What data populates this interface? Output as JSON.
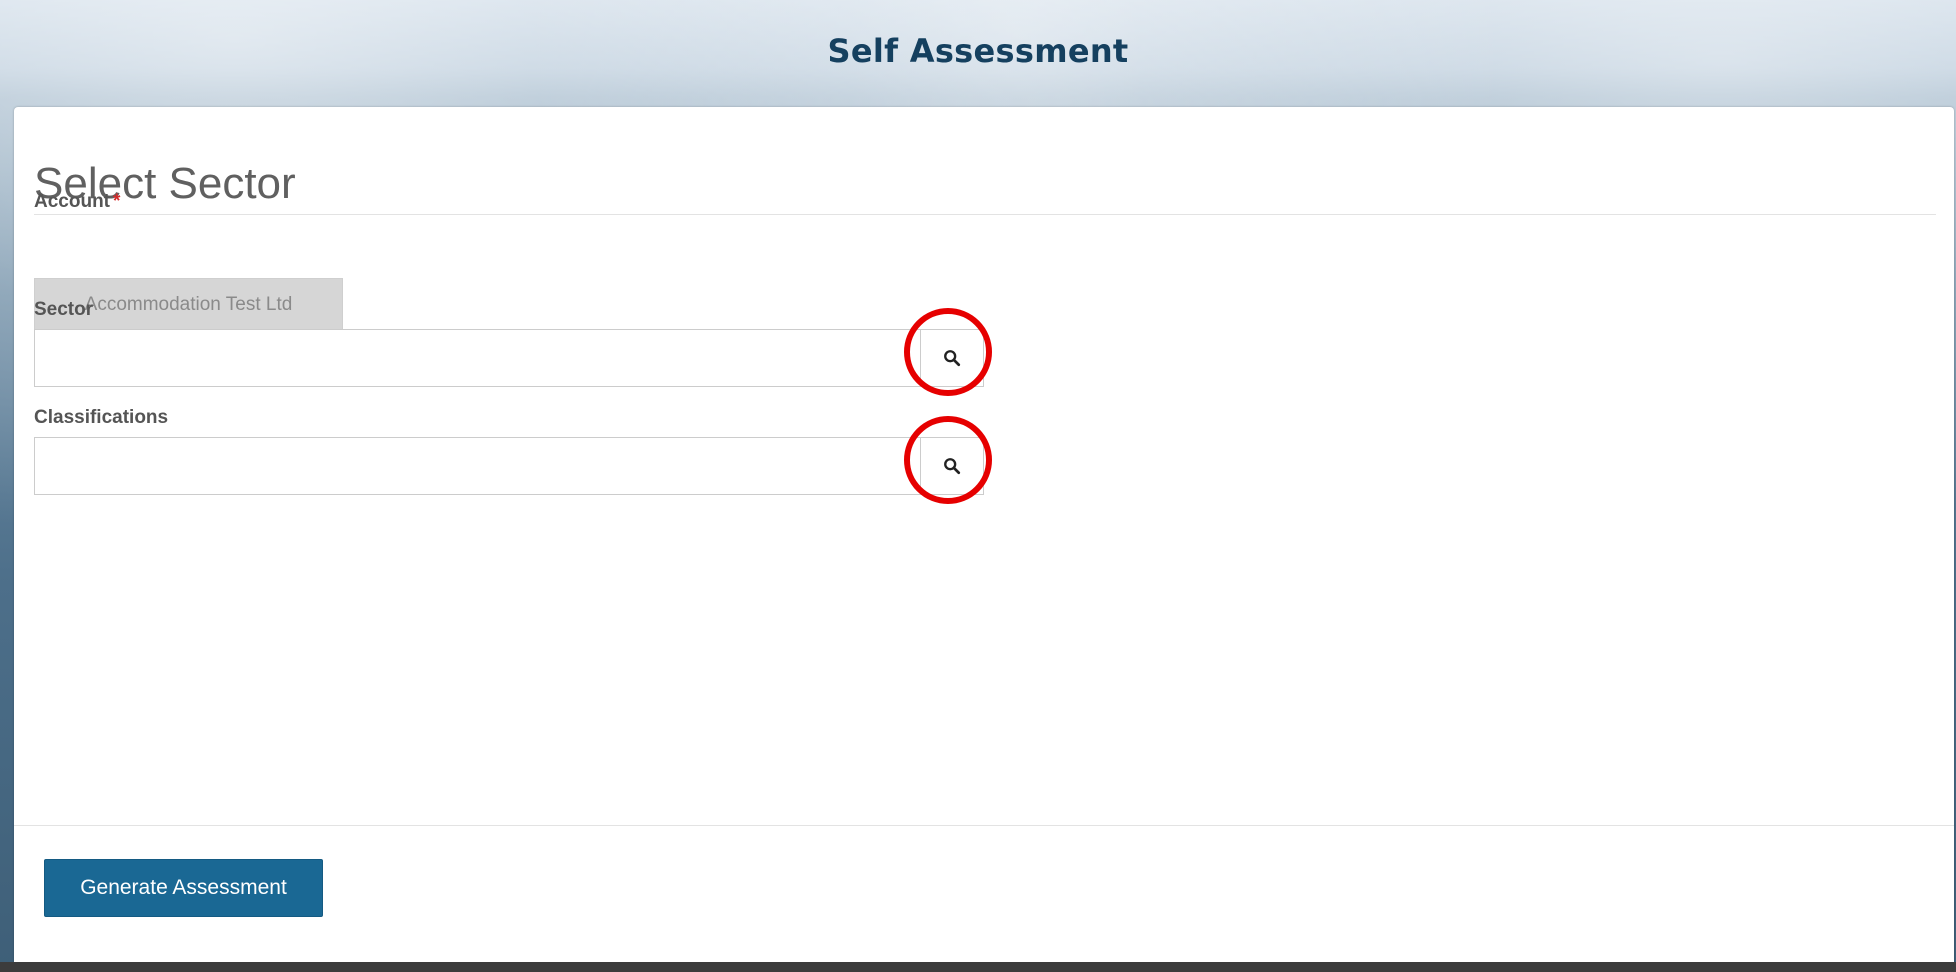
{
  "header": {
    "title": "Self Assessment"
  },
  "form": {
    "title": "Select Sector",
    "account": {
      "label": "Account",
      "required_mark": "*",
      "value": "Accommodation Test Ltd"
    },
    "sector": {
      "label": "Sector",
      "value": "",
      "lookup_icon": "search-icon"
    },
    "classifications": {
      "label": "Classifications",
      "value": "",
      "lookup_icon": "search-icon"
    },
    "submit_label": "Generate Assessment"
  },
  "colors": {
    "header_text": "#15405f",
    "primary_button": "#1a6894",
    "highlight_ring": "#e60000",
    "required_mark": "#d42a2a"
  }
}
